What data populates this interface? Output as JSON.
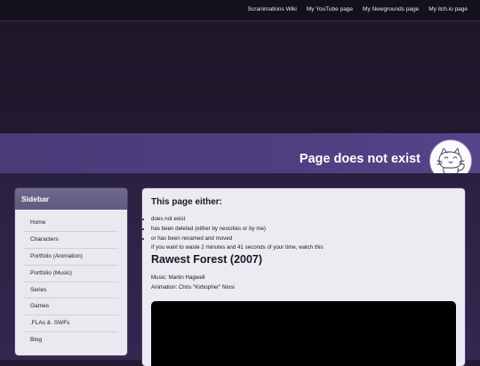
{
  "nav": {
    "links": [
      "Scranimations Wiki",
      "My YouTube page",
      "My Newgrounds page",
      "My itch.io page"
    ]
  },
  "banner": {
    "title": "Page does not exist",
    "mascot_icon": "cat-mascot-avatar"
  },
  "sidebar": {
    "title": "Sidebar",
    "items": [
      "Home",
      "Characters",
      "Portfolio (Animation)",
      "Portfolio (Music)",
      "Series",
      "Games",
      ".FLAs & .SWFs",
      "Blog"
    ]
  },
  "main": {
    "heading": "This page either:",
    "reasons": [
      "does not exist",
      "has been deleted (either by neocities or by me)",
      "or has been renamed and moved"
    ],
    "waste_text": "If you want to waste 2 minutes and 41 seconds of your time, watch this",
    "video_title": "Rawest Forest (2007)",
    "music_credit": "Music: Martin Hagwell",
    "animation_credit": "Animation: Chris \"Kirbopher\" Niosi"
  },
  "colors": {
    "banner": "#4f3f80",
    "page_background": "#241b33",
    "panel": "#ecebf1",
    "sidebar_header": "#6e6a8c"
  }
}
